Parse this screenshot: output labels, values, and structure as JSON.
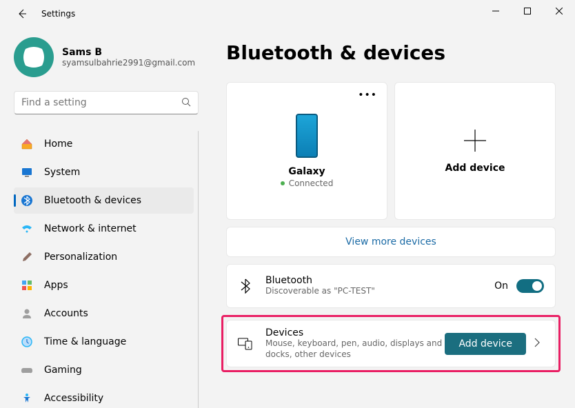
{
  "app_title": "Settings",
  "user": {
    "name": "Sams B",
    "email": "syamsulbahrie2991@gmail.com"
  },
  "search": {
    "placeholder": "Find a setting"
  },
  "nav": [
    {
      "id": "home",
      "label": "Home"
    },
    {
      "id": "system",
      "label": "System"
    },
    {
      "id": "bluetooth",
      "label": "Bluetooth & devices",
      "active": true
    },
    {
      "id": "network",
      "label": "Network & internet"
    },
    {
      "id": "personalization",
      "label": "Personalization"
    },
    {
      "id": "apps",
      "label": "Apps"
    },
    {
      "id": "accounts",
      "label": "Accounts"
    },
    {
      "id": "time",
      "label": "Time & language"
    },
    {
      "id": "gaming",
      "label": "Gaming"
    },
    {
      "id": "accessibility",
      "label": "Accessibility"
    }
  ],
  "page": {
    "title": "Bluetooth & devices"
  },
  "device": {
    "name": "Galaxy",
    "status": "Connected"
  },
  "add_device_card": "Add device",
  "view_more": "View more devices",
  "bluetooth_row": {
    "title": "Bluetooth",
    "sub": "Discoverable as \"PC-TEST\"",
    "state": "On"
  },
  "devices_row": {
    "title": "Devices",
    "sub": "Mouse, keyboard, pen, audio, displays and docks, other devices",
    "button": "Add device"
  }
}
